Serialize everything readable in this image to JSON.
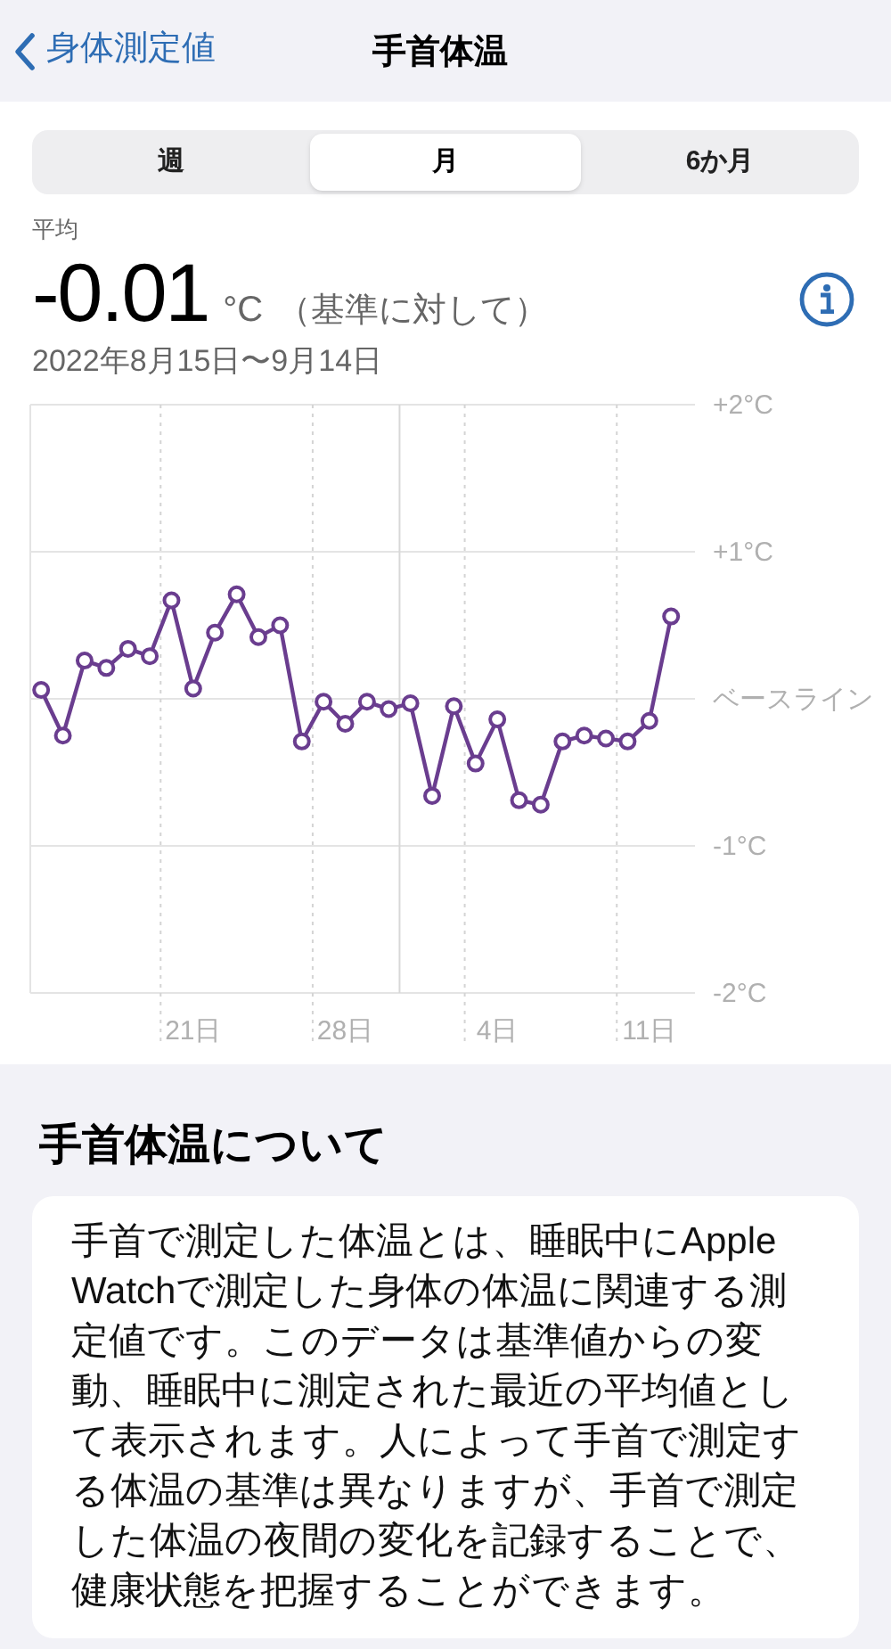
{
  "nav": {
    "back": "身体測定値",
    "title": "手首体温"
  },
  "segments": [
    {
      "label": "週",
      "selected": false
    },
    {
      "label": "月",
      "selected": true
    },
    {
      "label": "6か月",
      "selected": false
    }
  ],
  "summary": {
    "label": "平均",
    "value": "-0.01",
    "unit": "°C",
    "qualifier": "（基準に対して）",
    "date_range": "2022年8月15日〜9月14日"
  },
  "chart": {
    "chart_data": {
      "type": "line",
      "grid": true,
      "categories": [
        null,
        null,
        null,
        null,
        null,
        null,
        null,
        "21日",
        null,
        null,
        null,
        null,
        null,
        null,
        "28日",
        null,
        null,
        null,
        null,
        null,
        null,
        "4日",
        null,
        null,
        null,
        null,
        null,
        null,
        "11日",
        null
      ],
      "series": [
        {
          "color": "#6a3d8f",
          "marker": "circle",
          "values": [
            0.06,
            -0.25,
            0.26,
            0.21,
            0.34,
            0.29,
            0.67,
            0.07,
            0.45,
            0.71,
            0.42,
            0.5,
            -0.29,
            -0.02,
            -0.17,
            -0.02,
            -0.07,
            -0.03,
            -0.66,
            -0.05,
            -0.44,
            -0.14,
            -0.69,
            -0.72,
            -0.29,
            -0.25,
            -0.27,
            -0.29,
            -0.15,
            0.56
          ]
        }
      ],
      "ylim": [
        -2,
        2
      ],
      "yticks": [
        {
          "value": 2,
          "label": "+2°C"
        },
        {
          "value": 1,
          "label": "+1°C"
        },
        {
          "value": 0,
          "label": "ベースライン"
        },
        {
          "value": -1,
          "label": "-1°C"
        },
        {
          "value": -2,
          "label": "-2°C"
        }
      ]
    }
  },
  "about": {
    "heading": "手首体温について",
    "body": "手首で測定した体温とは、睡眠中にApple Watchで測定した身体の体温に関連する測定値です。このデータは基準値からの変動、睡眠中に測定された最近の平均値として表示されます。人によって手首で測定する体温の基準は異なりますが、手首で測定した体温の夜間の変化を記録することで、健康状態を把握することができます。"
  }
}
